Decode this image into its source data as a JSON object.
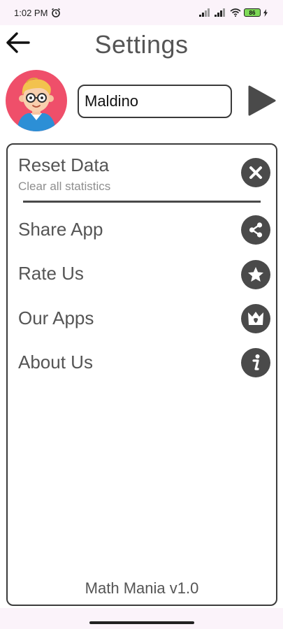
{
  "status_bar": {
    "time": "1:02 PM",
    "alarm_icon": "alarm-clock-icon",
    "signal_icon": "cell-signal-icon",
    "wifi_icon": "wifi-icon",
    "battery_level": "86",
    "charging_icon": "charging-bolt-icon"
  },
  "header": {
    "title": "Settings",
    "back_icon": "arrow-left-icon"
  },
  "profile": {
    "avatar_icon": "boy-with-glasses-avatar",
    "name_value": "Maldino",
    "play_icon": "play-triangle-icon"
  },
  "menu": {
    "items": [
      {
        "label": "Reset Data",
        "sublabel": "Clear all statistics",
        "icon": "close-circle-icon"
      },
      {
        "label": "Share App",
        "icon": "share-icon"
      },
      {
        "label": "Rate Us",
        "icon": "star-icon"
      },
      {
        "label": "Our Apps",
        "icon": "crown-icon"
      },
      {
        "label": "About Us",
        "icon": "info-icon"
      }
    ]
  },
  "footer": {
    "version": "Math Mania v1.0"
  },
  "colors": {
    "icon_bg": "#4a4a4a",
    "avatar_bg": "#ef4f6a",
    "text": "#555555"
  }
}
